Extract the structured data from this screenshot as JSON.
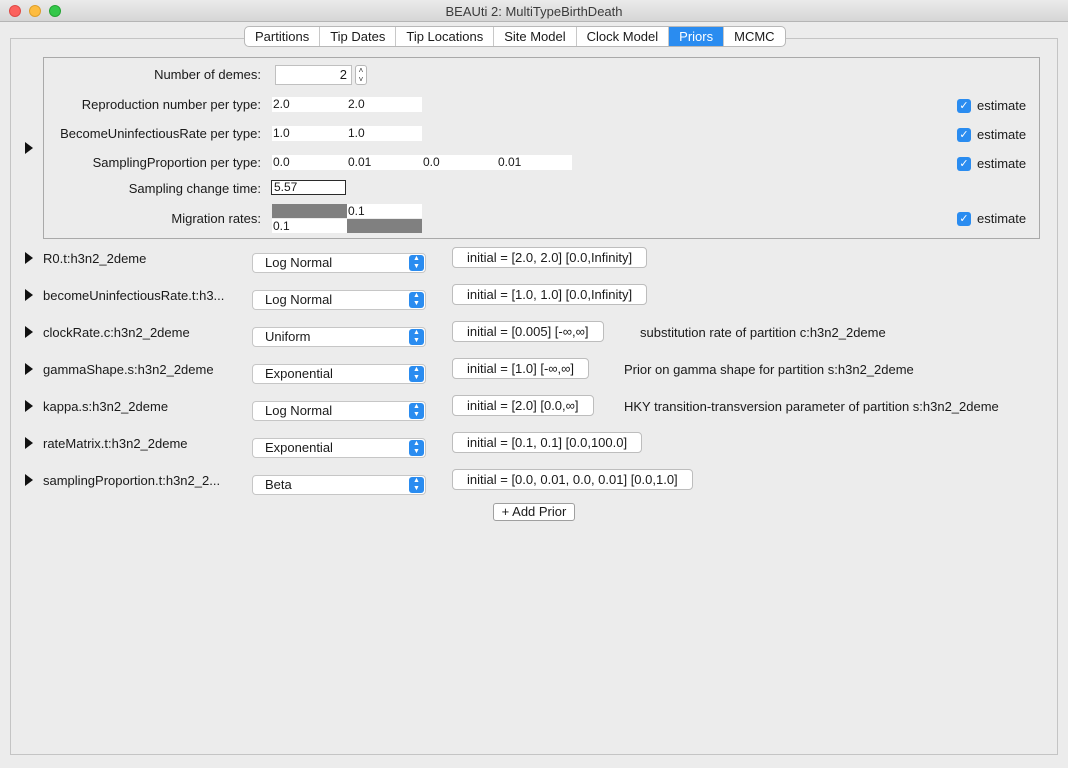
{
  "window": {
    "title": "BEAUti 2: MultiTypeBirthDeath"
  },
  "tabs": [
    "Partitions",
    "Tip Dates",
    "Tip Locations",
    "Site Model",
    "Clock Model",
    "Priors",
    "MCMC"
  ],
  "active_tab": "Priors",
  "colors": {
    "accent": "#2a8cf0",
    "grey_cell": "#808080"
  },
  "params": {
    "demes_label": "Number of demes:",
    "demes_value": "2",
    "repro_label": "Reproduction number per type:",
    "repro_values": [
      "2.0",
      "2.0"
    ],
    "uninf_label": "BecomeUninfectiousRate per type:",
    "uninf_values": [
      "1.0",
      "1.0"
    ],
    "samp_label": "SamplingProportion per type:",
    "samp_values": [
      "0.0",
      "0.01",
      "0.0",
      "0.01"
    ],
    "change_label": "Sampling change time:",
    "change_value": "5.57",
    "mig_label": "Migration rates:",
    "mig_values": [
      "0.1",
      "0.1"
    ],
    "estimate_label": "estimate"
  },
  "priors": [
    {
      "name": "R0.t:h3n2_2deme",
      "dist": "Log Normal",
      "initial": "initial = [2.0, 2.0] [0.0,Infinity]",
      "desc": ""
    },
    {
      "name": "becomeUninfectiousRate.t:h3...",
      "dist": "Log Normal",
      "initial": "initial = [1.0, 1.0] [0.0,Infinity]",
      "desc": ""
    },
    {
      "name": "clockRate.c:h3n2_2deme",
      "dist": "Uniform",
      "initial": "initial = [0.005] [-∞,∞]",
      "desc": "substitution rate of partition c:h3n2_2deme"
    },
    {
      "name": "gammaShape.s:h3n2_2deme",
      "dist": "Exponential",
      "initial": "initial = [1.0] [-∞,∞]",
      "desc": "Prior on gamma shape for partition s:h3n2_2deme"
    },
    {
      "name": "kappa.s:h3n2_2deme",
      "dist": "Log Normal",
      "initial": "initial = [2.0] [0.0,∞]",
      "desc": "HKY transition-transversion parameter of partition s:h3n2_2deme"
    },
    {
      "name": "rateMatrix.t:h3n2_2deme",
      "dist": "Exponential",
      "initial": "initial = [0.1, 0.1] [0.0,100.0]",
      "desc": ""
    },
    {
      "name": "samplingProportion.t:h3n2_2...",
      "dist": "Beta",
      "initial": "initial = [0.0, 0.01, 0.0, 0.01] [0.0,1.0]",
      "desc": ""
    }
  ],
  "add_prior_label": "+ Add Prior"
}
